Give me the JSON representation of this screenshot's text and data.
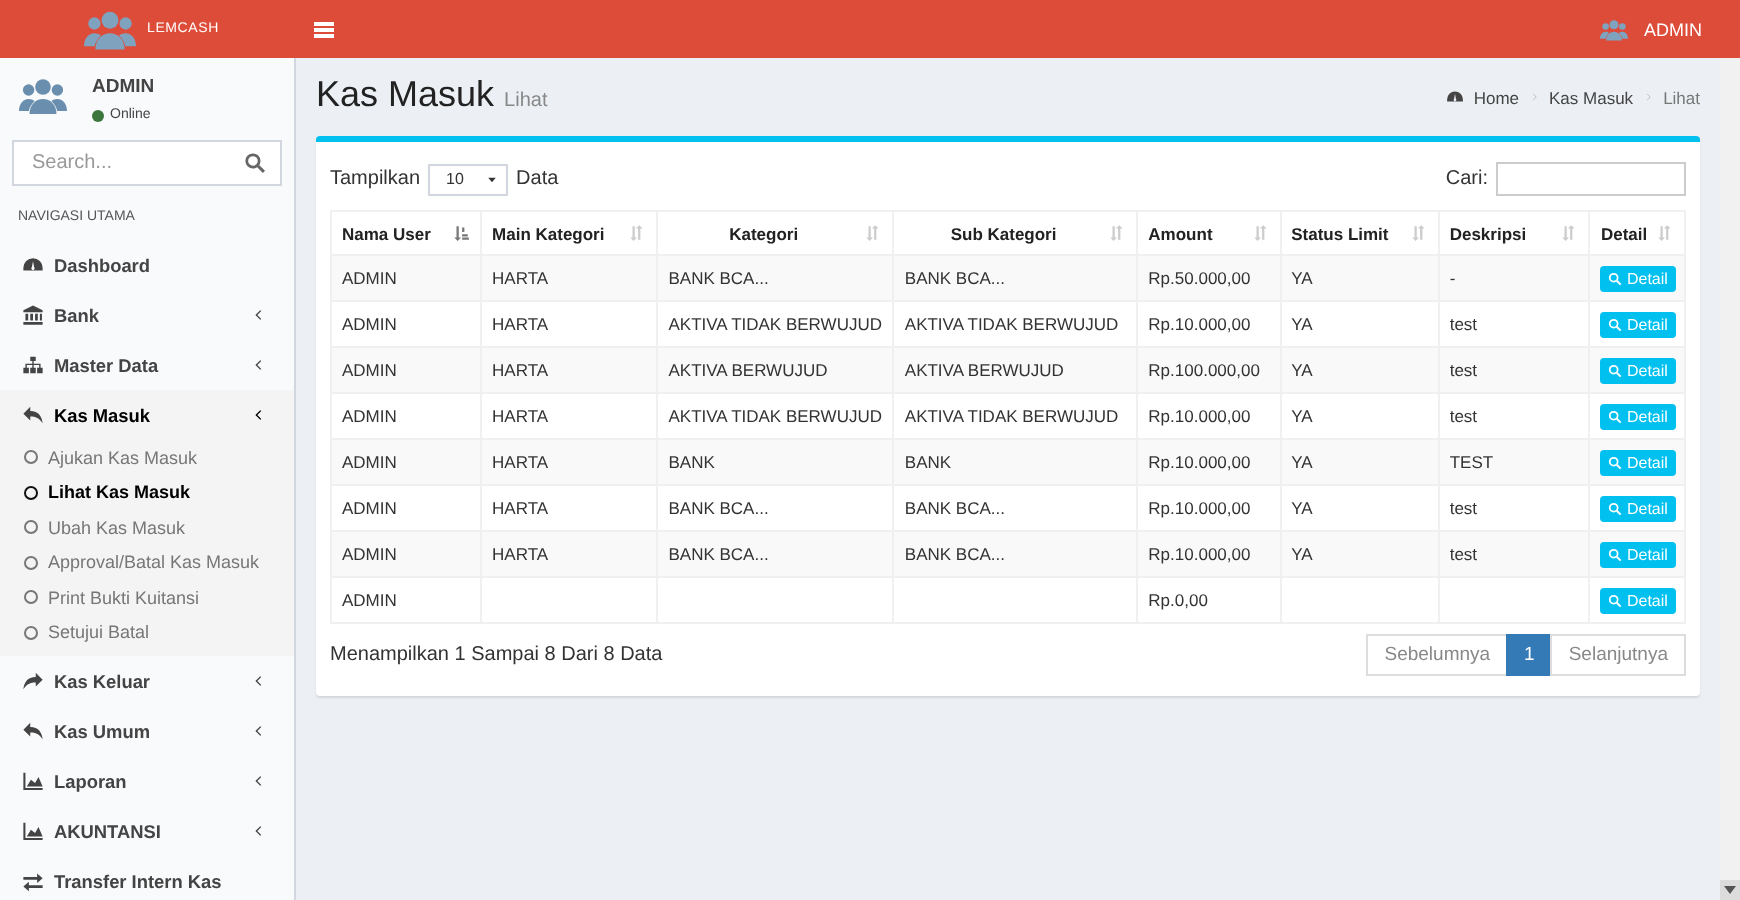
{
  "header": {
    "logo_text": "LEMCASH",
    "user": "ADMIN"
  },
  "sidebar": {
    "user": {
      "name": "ADMIN",
      "status": "Online"
    },
    "search": {
      "placeholder": "Search..."
    },
    "section_label": "NAVIGASI UTAMA",
    "items": [
      {
        "label": "Dashboard",
        "has_submenu": false,
        "selected": false
      },
      {
        "label": "Bank",
        "has_submenu": true,
        "selected": false
      },
      {
        "label": "Master Data",
        "has_submenu": true,
        "selected": false
      },
      {
        "label": "Kas Masuk",
        "has_submenu": true,
        "selected": true,
        "children": [
          {
            "label": "Ajukan Kas Masuk",
            "selected": false
          },
          {
            "label": "Lihat Kas Masuk",
            "selected": true
          },
          {
            "label": "Ubah Kas Masuk",
            "selected": false
          },
          {
            "label": "Approval/Batal Kas Masuk",
            "selected": false
          },
          {
            "label": "Print Bukti Kuitansi",
            "selected": false
          },
          {
            "label": "Setujui Batal",
            "selected": false
          }
        ]
      },
      {
        "label": "Kas Keluar",
        "has_submenu": true,
        "selected": false
      },
      {
        "label": "Kas Umum",
        "has_submenu": true,
        "selected": false
      },
      {
        "label": "Laporan",
        "has_submenu": true,
        "selected": false
      },
      {
        "label": "AKUNTANSI",
        "has_submenu": true,
        "selected": false
      },
      {
        "label": "Transfer Intern Kas",
        "has_submenu": false,
        "selected": false
      }
    ]
  },
  "page": {
    "title": "Kas Masuk",
    "subtitle": "Lihat",
    "breadcrumb": [
      {
        "label": "Home"
      },
      {
        "label": "Kas Masuk"
      },
      {
        "label": "Lihat"
      }
    ]
  },
  "table_controls": {
    "length_label": "Tampilkan",
    "length_value": "10",
    "length_suffix": "Data",
    "search_label": "Cari:"
  },
  "table": {
    "columns": [
      {
        "label": "Nama User",
        "sorted": true
      },
      {
        "label": "Main Kategori",
        "sorted": false
      },
      {
        "label": "Kategori",
        "sorted": false
      },
      {
        "label": "Sub Kategori",
        "sorted": false
      },
      {
        "label": "Amount",
        "sorted": false
      },
      {
        "label": "Status Limit",
        "sorted": false
      },
      {
        "label": "Deskripsi",
        "sorted": false
      },
      {
        "label": "Detail",
        "sorted": false
      }
    ],
    "rows": [
      {
        "cells": [
          "ADMIN",
          "HARTA",
          "BANK BCA...",
          "BANK BCA...",
          "Rp.50.000,00",
          "YA",
          "-"
        ],
        "action": "Detail"
      },
      {
        "cells": [
          "ADMIN",
          "HARTA",
          "AKTIVA TIDAK BERWUJUD",
          "AKTIVA TIDAK BERWUJUD",
          "Rp.10.000,00",
          "YA",
          "test"
        ],
        "action": "Detail"
      },
      {
        "cells": [
          "ADMIN",
          "HARTA",
          "AKTIVA BERWUJUD",
          "AKTIVA BERWUJUD",
          "Rp.100.000,00",
          "YA",
          "test"
        ],
        "action": "Detail"
      },
      {
        "cells": [
          "ADMIN",
          "HARTA",
          "AKTIVA TIDAK BERWUJUD",
          "AKTIVA TIDAK BERWUJUD",
          "Rp.10.000,00",
          "YA",
          "test"
        ],
        "action": "Detail"
      },
      {
        "cells": [
          "ADMIN",
          "HARTA",
          "BANK",
          "BANK",
          "Rp.10.000,00",
          "YA",
          "TEST"
        ],
        "action": "Detail"
      },
      {
        "cells": [
          "ADMIN",
          "HARTA",
          "BANK BCA...",
          "BANK BCA...",
          "Rp.10.000,00",
          "YA",
          "test"
        ],
        "action": "Detail"
      },
      {
        "cells": [
          "ADMIN",
          "HARTA",
          "BANK BCA...",
          "BANK BCA...",
          "Rp.10.000,00",
          "YA",
          "test"
        ],
        "action": "Detail"
      },
      {
        "cells": [
          "ADMIN",
          null,
          null,
          null,
          "Rp.0,00",
          null,
          null
        ],
        "action": "Detail"
      }
    ]
  },
  "table_footer": {
    "info": "Menampilkan 1 Sampai 8 Dari 8 Data",
    "pagination": [
      {
        "label": "Sebelumnya",
        "selected": false,
        "disabled": true
      },
      {
        "label": "1",
        "selected": true,
        "disabled": false
      },
      {
        "label": "Selanjutnya",
        "selected": false,
        "disabled": true
      }
    ]
  }
}
